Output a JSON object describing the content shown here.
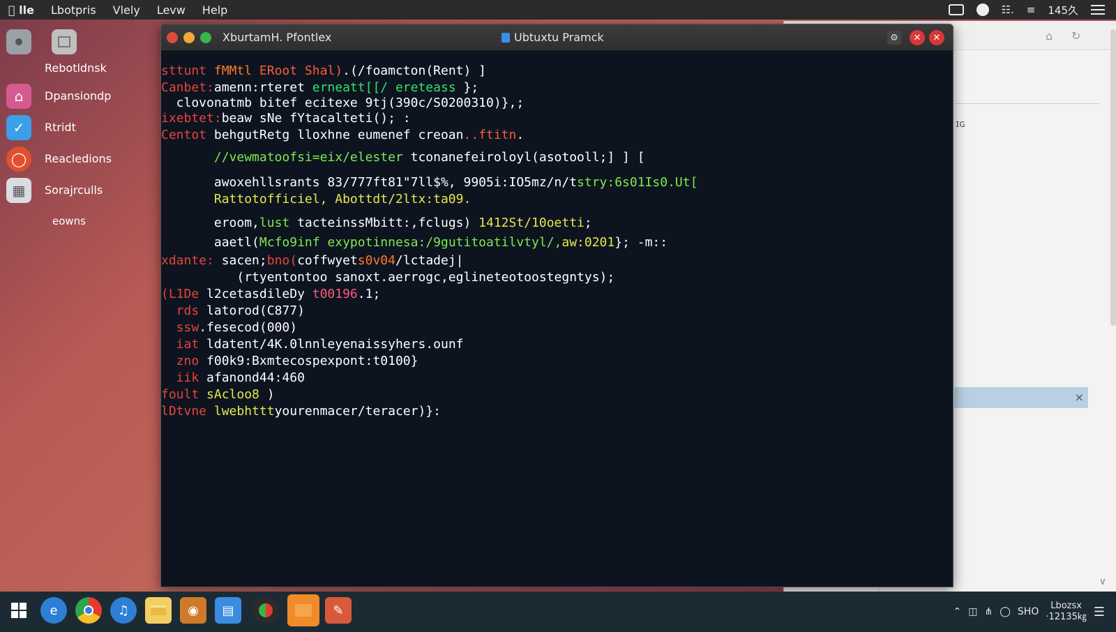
{
  "menubar": {
    "items": [
      "lle",
      "Lbotpris",
      "Vlely",
      "Levw",
      "Help"
    ],
    "tray": {
      "time": "145久"
    }
  },
  "launcher": {
    "items": [
      {
        "label": "Rebotldnsk"
      },
      {
        "label": "Dpansiondp"
      },
      {
        "label": "Rtridt"
      },
      {
        "label": "Reacledions"
      },
      {
        "label": "Sorajrculls"
      },
      {
        "label": "eowns"
      }
    ]
  },
  "bgwin": {
    "fragment": "ɪɢ",
    "close": "×"
  },
  "terminal": {
    "title_left": "XburtamH. Pfontlex",
    "title_center": "Ubtuxtu Pramck",
    "lines": [
      {
        "segs": [
          {
            "t": "sttunt ",
            "c": "#e8443a"
          },
          {
            "t": "fMMtl ",
            "c": "#ff7a2a"
          },
          {
            "t": "ERoot Shal)",
            "c": "#ff5a3a"
          },
          {
            "t": ".(/foamcton(Rent) ]",
            "c": "#ffffff"
          }
        ]
      },
      {
        "segs": [
          {
            "t": "Canbet:",
            "c": "#e8443a"
          },
          {
            "t": "amenn:rteret ",
            "c": "#ffffff"
          },
          {
            "t": "erneatt[[/ ereteass ",
            "c": "#2fe36b"
          },
          {
            "t": "};",
            "c": "#ffffff"
          }
        ]
      },
      {
        "segs": [
          {
            "t": "  clovonatmb bitef ecitexe 9tj(390c/S0200310)},;",
            "c": "#ffffff"
          }
        ]
      },
      {
        "segs": [
          {
            "t": "ixebtet:",
            "c": "#e8443a"
          },
          {
            "t": "beaw sNe fYtacalteti(); :",
            "c": "#ffffff"
          }
        ]
      },
      {
        "segs": [
          {
            "t": "Centot ",
            "c": "#e8443a"
          },
          {
            "t": "behgutRetg lloxhne eumenef creoan",
            "c": "#ffffff"
          },
          {
            "t": "..ftitn",
            "c": "#ff5a3a"
          },
          {
            "t": ".",
            "c": "#ffffff"
          }
        ]
      },
      {
        "segs": [
          {
            "t": "       //vewmatoofsi=eix/elester ",
            "c": "#7fea4b"
          },
          {
            "t": "tconanefeiroloyl(asotooll;] ] [",
            "c": "#ffffff"
          }
        ]
      },
      {
        "segs": [
          {
            "t": "       awoxehllsrants 83/777ft81\"7ll$%, 9905i:IO5mz/n/t",
            "c": "#ffffff"
          },
          {
            "t": "stry:6s01Is0.Ut[",
            "c": "#7fea4b"
          }
        ]
      },
      {
        "segs": [
          {
            "t": "       Rattotofficiel, Abottdt/2ltx:ta09.",
            "c": "#e6e94a"
          }
        ]
      },
      {
        "segs": [
          {
            "t": "       eroom,",
            "c": "#ffffff"
          },
          {
            "t": "lust ",
            "c": "#7fea4b"
          },
          {
            "t": "tacteinssMbitt:,fclugs) ",
            "c": "#ffffff"
          },
          {
            "t": "1412St/10oetti",
            "c": "#e6e94a"
          },
          {
            "t": ";",
            "c": "#ffffff"
          }
        ]
      },
      {
        "segs": [
          {
            "t": "       aaetl(",
            "c": "#ffffff"
          },
          {
            "t": "Mcfo9inf exypotinnesa:/9gutitoatilvtyl/,",
            "c": "#7fea4b"
          },
          {
            "t": "aw:0201",
            "c": "#e6e94a"
          },
          {
            "t": "}; -m::",
            "c": "#ffffff"
          }
        ]
      },
      {
        "segs": [
          {
            "t": "xdante: ",
            "c": "#e8443a"
          },
          {
            "t": "sacen;",
            "c": "#ffffff"
          },
          {
            "t": "bno(",
            "c": "#e8443a"
          },
          {
            "t": "coffwyet",
            "c": "#ffffff"
          },
          {
            "t": "s0v04",
            "c": "#ff7a2a"
          },
          {
            "t": "/lctadej|",
            "c": "#ffffff"
          }
        ]
      },
      {
        "segs": [
          {
            "t": "          (rtyentontoo sanoxt.aerrogc,eglineteotoostegntys);",
            "c": "#ffffff"
          }
        ]
      },
      {
        "segs": [
          {
            "t": "(L1De ",
            "c": "#e8443a"
          },
          {
            "t": "l2cetasdileDy ",
            "c": "#ffffff"
          },
          {
            "t": "t00196",
            "c": "#ff5a7a"
          },
          {
            "t": ".1;",
            "c": "#ffffff"
          }
        ]
      },
      {
        "segs": [
          {
            "t": "  rds ",
            "c": "#e8443a"
          },
          {
            "t": "latorod(C877)",
            "c": "#ffffff"
          }
        ]
      },
      {
        "segs": [
          {
            "t": "  ssw",
            "c": "#e8443a"
          },
          {
            "t": ".fesecod(000)",
            "c": "#ffffff"
          }
        ]
      },
      {
        "segs": [
          {
            "t": "  iat ",
            "c": "#e8443a"
          },
          {
            "t": "ldatent/4K.0lnnleyenaissyhers.ounf",
            "c": "#ffffff"
          }
        ]
      },
      {
        "segs": [
          {
            "t": "  zno ",
            "c": "#e8443a"
          },
          {
            "t": "f00k9:Bxmtecospexpont:t0100}",
            "c": "#ffffff"
          }
        ]
      },
      {
        "segs": [
          {
            "t": "  iik ",
            "c": "#e8443a"
          },
          {
            "t": "afanond44:460",
            "c": "#ffffff"
          }
        ]
      },
      {
        "segs": [
          {
            "t": "foult ",
            "c": "#e8443a"
          },
          {
            "t": "sAcloo8 ",
            "c": "#e6e94a"
          },
          {
            "t": ")",
            "c": "#ffffff"
          }
        ]
      },
      {
        "segs": [
          {
            "t": "lDtvne ",
            "c": "#e8443a"
          },
          {
            "t": "lwebhttt",
            "c": "#e6e94a"
          },
          {
            "t": "yourenmacer/teracer)}:",
            "c": "#ffffff"
          }
        ]
      }
    ]
  },
  "taskbar": {
    "tray": {
      "text": "SHO",
      "clock_line1": "Lbozsx",
      "clock_line2": "·12135㎏"
    }
  },
  "colors": {
    "terminal_bg": "#0d1420",
    "taskbar_bg": "#1c2b33",
    "menubar_bg": "#2b2b2b"
  }
}
